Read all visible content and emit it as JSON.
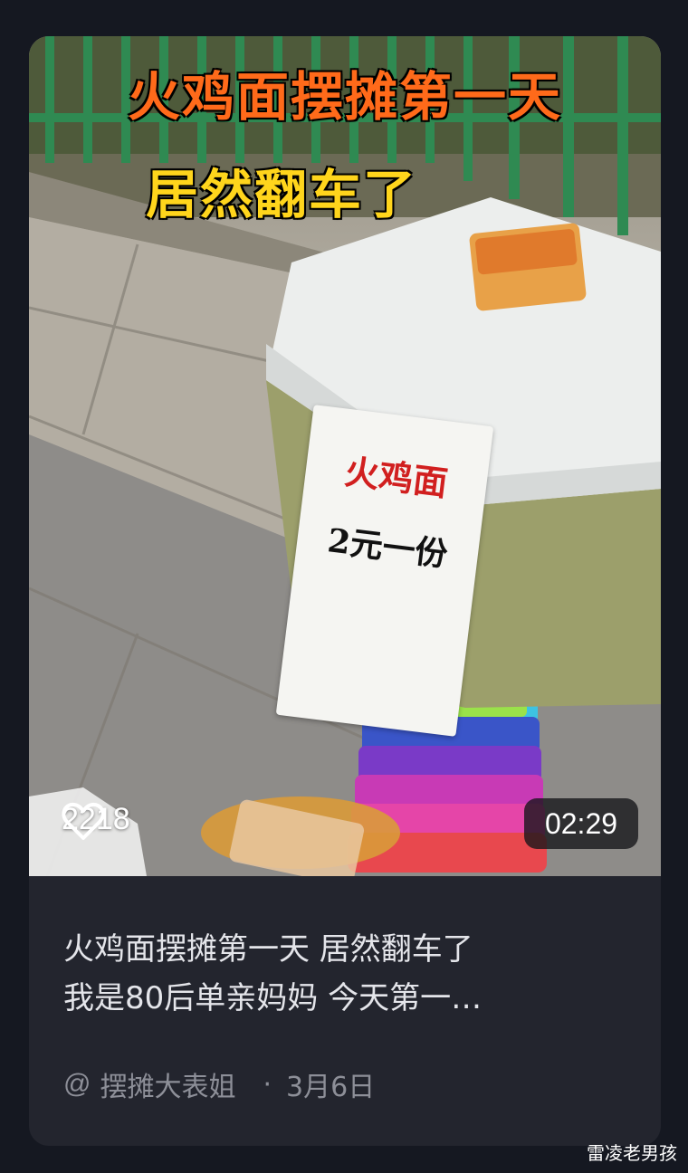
{
  "video_card": {
    "overlay_title_line1": "火鸡面摆摊第一天",
    "overlay_title_line2": "居然翻车了",
    "sign_line1": "火鸡面",
    "sign_line2": "2元一份",
    "likes": "2218",
    "duration": "02:29",
    "description_line1": "火鸡面摆摊第一天 居然翻车了",
    "description_line2": "我是80后单亲妈妈 今天第一…",
    "author_prefix": "@",
    "author": "摆摊大表姐",
    "separator": "·",
    "date": "3月6日"
  },
  "watermark": "雷凌老男孩",
  "icons": [
    "heart-icon"
  ],
  "colors": {
    "background": "#151821",
    "card": "#23252e",
    "title_orange": "#ff6a1a",
    "title_yellow": "#ffd51c",
    "meta_text": "#8d8f98"
  }
}
